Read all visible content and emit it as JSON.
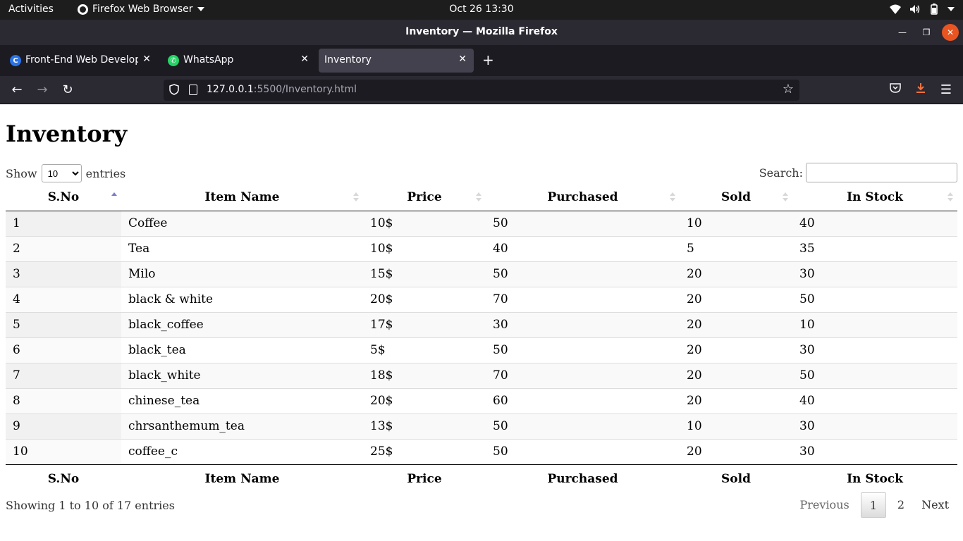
{
  "topbar": {
    "activities": "Activities",
    "app_menu": "Firefox Web Browser",
    "clock": "Oct 26  13:30"
  },
  "window": {
    "title": "Inventory — Mozilla Firefox"
  },
  "tabs": [
    {
      "label": "Front-End Web Developm",
      "favicon": "C"
    },
    {
      "label": "WhatsApp"
    },
    {
      "label": "Inventory"
    }
  ],
  "url": {
    "host": "127.0.0.1",
    "rest": ":5500/Inventory.html"
  },
  "page": {
    "heading": "Inventory",
    "show_label": "Show",
    "entries_label": "entries",
    "length_selected": "10",
    "search_label": "Search:",
    "search_value": "",
    "columns": [
      "S.No",
      "Item Name",
      "Price",
      "Purchased",
      "Sold",
      "In Stock"
    ],
    "rows": [
      [
        "1",
        "Coffee",
        "10$",
        "50",
        "10",
        "40"
      ],
      [
        "2",
        "Tea",
        "10$",
        "40",
        "5",
        "35"
      ],
      [
        "3",
        "Milo",
        "15$",
        "50",
        "20",
        "30"
      ],
      [
        "4",
        "black & white",
        "20$",
        "70",
        "20",
        "50"
      ],
      [
        "5",
        "black_coffee",
        "17$",
        "30",
        "20",
        "10"
      ],
      [
        "6",
        "black_tea",
        "5$",
        "50",
        "20",
        "30"
      ],
      [
        "7",
        "black_white",
        "18$",
        "70",
        "20",
        "50"
      ],
      [
        "8",
        "chinese_tea",
        "20$",
        "60",
        "20",
        "40"
      ],
      [
        "9",
        "chrsanthemum_tea",
        "13$",
        "50",
        "10",
        "30"
      ],
      [
        "10",
        "coffee_c",
        "25$",
        "50",
        "20",
        "30"
      ]
    ],
    "info": "Showing 1 to 10 of 17 entries",
    "pagination": {
      "previous": "Previous",
      "pages": [
        "1",
        "2"
      ],
      "current": "1",
      "next": "Next"
    }
  },
  "colors": {
    "close_button": "#e95420",
    "sort_active": "#7b7bc8",
    "download_icon": "#ff7139"
  }
}
